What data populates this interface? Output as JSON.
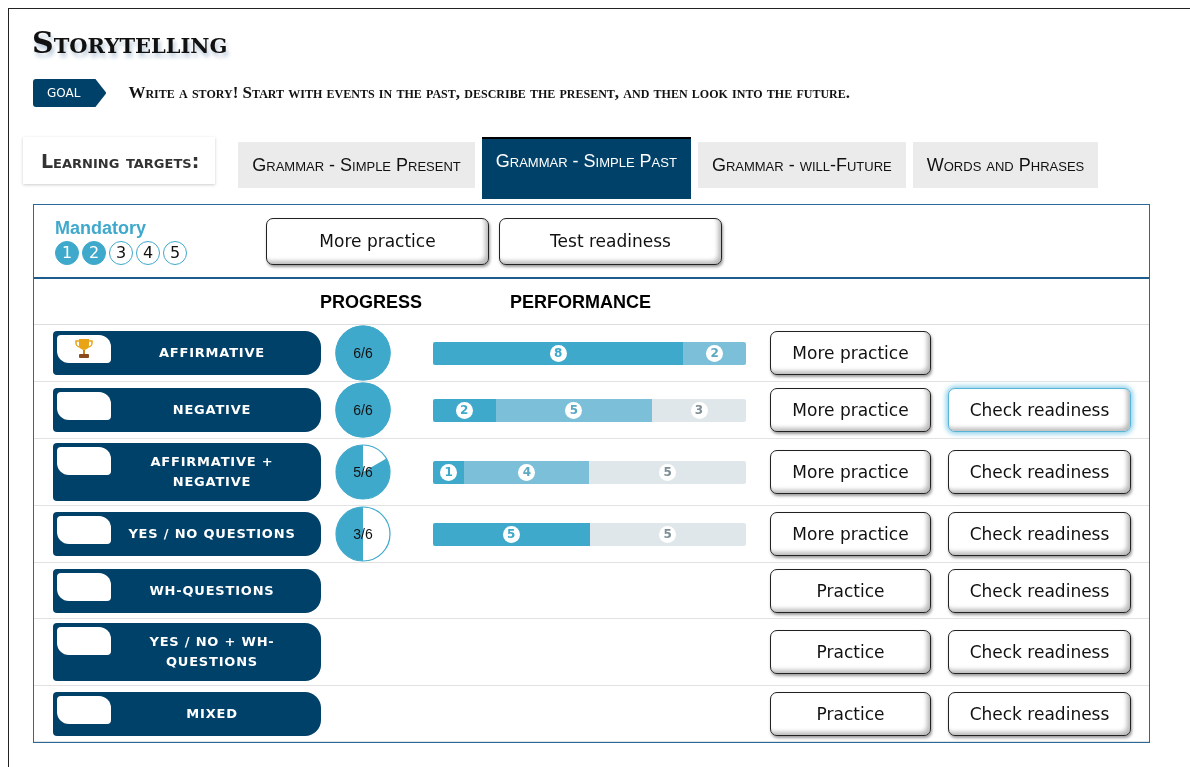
{
  "title": "Storytelling",
  "goal": {
    "badge": "GOAL",
    "text": "Write a story! Start with events in the past, describe the present, and then look into the future."
  },
  "targets": {
    "label": "Learning targets:",
    "tabs": [
      {
        "label": "Grammar - Simple Present",
        "selected": false
      },
      {
        "label": "Grammar - Simple Past",
        "selected": true
      },
      {
        "label": "Grammar - will-Future",
        "selected": false
      },
      {
        "label": "Words and Phrases",
        "selected": false
      }
    ]
  },
  "mandatory": {
    "label": "Mandatory",
    "steps": [
      {
        "label": "1",
        "done": true
      },
      {
        "label": "2",
        "done": true
      },
      {
        "label": "3",
        "done": false
      },
      {
        "label": "4",
        "done": false
      },
      {
        "label": "5",
        "done": false
      }
    ],
    "buttons": [
      "More practice",
      "Test readiness"
    ]
  },
  "columns": [
    "PROGRESS",
    "PERFORMANCE"
  ],
  "rows": [
    {
      "label": "AFFIRMATIVE",
      "trophy": true,
      "progress": {
        "text": "6/6"
      },
      "performance": [
        {
          "kind": "dark",
          "label": "8"
        },
        {
          "kind": "light",
          "label": "2"
        }
      ],
      "buttons": [
        {
          "label": "More practice",
          "focused": false
        }
      ]
    },
    {
      "label": "NEGATIVE",
      "trophy": false,
      "progress": {
        "text": "6/6"
      },
      "performance": [
        {
          "kind": "dark",
          "label": "2"
        },
        {
          "kind": "light",
          "label": "5"
        },
        {
          "kind": "empty",
          "label": "3"
        }
      ],
      "buttons": [
        {
          "label": "More practice",
          "focused": false
        },
        {
          "label": "Check readiness",
          "focused": true
        }
      ]
    },
    {
      "label": "AFFIRMATIVE + NEGATIVE",
      "trophy": false,
      "progress": {
        "text": "5/6"
      },
      "performance": [
        {
          "kind": "dark",
          "label": "1"
        },
        {
          "kind": "light",
          "label": "4"
        },
        {
          "kind": "empty",
          "label": "5"
        }
      ],
      "buttons": [
        {
          "label": "More practice",
          "focused": false
        },
        {
          "label": "Check readiness",
          "focused": false
        }
      ]
    },
    {
      "label": "YES / NO QUESTIONS",
      "trophy": false,
      "progress": {
        "text": "3/6"
      },
      "performance": [
        {
          "kind": "dark",
          "label": "5"
        },
        {
          "kind": "empty",
          "label": "5"
        }
      ],
      "buttons": [
        {
          "label": "More practice",
          "focused": false
        },
        {
          "label": "Check readiness",
          "focused": false
        }
      ]
    },
    {
      "label": "WH-QUESTIONS",
      "trophy": false,
      "buttons": [
        {
          "label": "Practice",
          "focused": false
        },
        {
          "label": "Check readiness",
          "focused": false
        }
      ]
    },
    {
      "label": "YES / NO + WH-QUESTIONS",
      "trophy": false,
      "buttons": [
        {
          "label": "Practice",
          "focused": false
        },
        {
          "label": "Check readiness",
          "focused": false
        }
      ]
    },
    {
      "label": "MIXED",
      "trophy": false,
      "buttons": [
        {
          "label": "Practice",
          "focused": false
        },
        {
          "label": "Check readiness",
          "focused": false
        }
      ]
    }
  ]
}
